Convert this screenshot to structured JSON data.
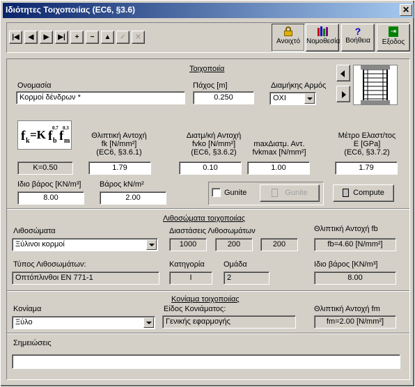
{
  "window": {
    "title": "Ιδιότητες Τοιχοποιίας (EC6, §3.6)",
    "close": "✕"
  },
  "toolbar": {
    "first": "|◀",
    "prev": "◀",
    "next": "▶",
    "last": "▶|",
    "add": "+",
    "remove": "−",
    "up": "▲",
    "confirm": "✓",
    "cancel": "✕",
    "open_label": "Ανοιχτό",
    "law_label": "Νομοθεσία",
    "help_label": "Βοήθεια",
    "exit_label": "Εξοδος",
    "help_glyph": "?",
    "exit_glyph": "⇥"
  },
  "masonry": {
    "section_title": "Τοιχοποιία",
    "name_label": "Ονομασία",
    "name_value": "Κορμοί δένδρων *",
    "thickness_label": "Πάχος [m]",
    "thickness_value": "0.250",
    "joint_label": "Διαμήκης Αρμός",
    "joint_value": "ΟΧΙ",
    "formula_fk": "f",
    "formula_k": "k",
    "formula_eq": "=K",
    "formula_fb": "f",
    "formula_b": "b",
    "formula_exp1": "0.7",
    "formula_fm": "f",
    "formula_m": "m",
    "formula_exp2": "0.3",
    "k_value": "K=0.50",
    "fk_label1": "Θλιπτική Αντοχή",
    "fk_label2": "fk [N/mm²]",
    "fk_label3": "(EC6, §3.6.1)",
    "fk_value": "1.79",
    "fvko_label1": "Διατμ/κή Αντοχή",
    "fvko_label2": "fvko [N/mm²]",
    "fvko_label3": "(EC6, §3.6.2)",
    "fvko_value": "0.10",
    "fvkmax_label1": "maxΔιατμ. Αντ.",
    "fvkmax_label2": "fvkmax [N/mm²]",
    "fvkmax_value": "1.00",
    "e_label1": "Μέτρο Ελαστ/τος",
    "e_label2": "E [GPa]",
    "e_label3": "(EC6, §3.7.2)",
    "e_value": "1.79",
    "weight_label": "Ιδιο βάρος [KN/m³]",
    "weight_value": "8.00",
    "weight2_label": "Βάρος kN/m²",
    "weight2_value": "2.00",
    "gunite_check_label": "Gunite",
    "gunite_button": "Gunite",
    "compute_button": "Compute"
  },
  "units": {
    "section_title": "Λιθοσώματα τοιχοποιίας",
    "units_label": "Λιθοσώματα",
    "units_value": "Ξύλινοι κορμοί",
    "dims_label": "Διαστάσεις Λιθοσωμάτων",
    "dim1": "1000",
    "dim2": "200",
    "dim3": "200",
    "fb_label": "Θλιπτική Αντοχή fb",
    "fb_value": "fb=4.60  [N/mm²]",
    "type_label": "Τύπος Λιθοσωμάτων:",
    "type_value": "Οπτόπλινθοι EN 771-1",
    "category_label": "Κατηγορία",
    "category_value": "I",
    "group_label": "Ομάδα",
    "group_value": "2",
    "weight_label": "Ιδιο βάρος [KN/m³]",
    "weight_value": "8.00"
  },
  "mortar": {
    "section_title": "Κονίαμα τοιχοποιίας",
    "mortar_label": "Κονίαμα",
    "mortar_value": "Ξύλο",
    "kind_label": "Είδος Κονιάματος:",
    "kind_value": "Γενικής εφαρμογής",
    "fm_label": "Θλιπτική Αντοχή fm",
    "fm_value": "fm=2.00  [N/mm²]"
  },
  "notes": {
    "label": "Σημειώσεις",
    "value": ""
  }
}
